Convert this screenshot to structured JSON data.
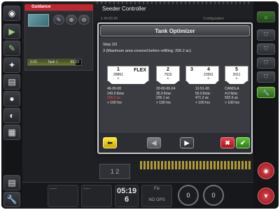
{
  "app": {
    "title": "Seeder Controller",
    "sub_header_left": "1   46-00-00",
    "sub_header_right": "Configuration"
  },
  "guidance": {
    "tab_label": "Guidance",
    "tank_bar": {
      "left": "0.00",
      "label": "Tank 1",
      "right": "89.22",
      "fill_fraction": 0.9
    }
  },
  "dialog": {
    "title": "Tank Optimizer",
    "step": "Step 2/2",
    "description": "3  (Maximum area covered before refilling: 206.2 ac)",
    "tanks": [
      {
        "id": "1",
        "capacity": "28861",
        "unit": "lb",
        "flex_label": "FLEX",
        "product": "46-00-00",
        "rate": "140.0 lb/ac",
        "area": "206.2 ac",
        "area_color": "#ff4a4a",
        "time": "> 100 hrs"
      },
      {
        "id": "2",
        "capacity": "7915",
        "unit": "lb",
        "product": "20-00-00-24",
        "rate": "35.0 lb/ac",
        "area": "226.1 ac",
        "area_color": "#e8e8e8",
        "time": "> 100 hrs"
      },
      {
        "id": "3",
        "id_b": "4",
        "capacity": "23561",
        "unit": "lb",
        "product": "12-51-00",
        "rate": "50.0 lb/ac",
        "area": "471.2 ac",
        "area_color": "#e8e8e8",
        "time": "> 100 hrs"
      },
      {
        "id": "5",
        "capacity": "2011",
        "unit": "lb",
        "product": "CANOLA",
        "rate": "4.0 lb/ac",
        "area": "502.6 ac",
        "area_color": "#e8e8e8",
        "time": "> 100 hrs"
      }
    ],
    "footer_icons": {
      "back": "arrow-left-icon",
      "previous": "triangle-left-icon",
      "next": "triangle-right-icon",
      "cancel": "x-icon",
      "confirm": "checkmark-icon"
    }
  },
  "status_bar": {
    "clock": "05:19",
    "count": "6",
    "count_label": "Fix",
    "gps": "NO GPS",
    "gauge_1": "0",
    "gauge_2": "0",
    "field_left": "1",
    "field_right": "2"
  },
  "colors": {
    "accent_green": "#5fc23a",
    "alert_red": "#c0262d",
    "warning_yellow": "#ffe640"
  }
}
